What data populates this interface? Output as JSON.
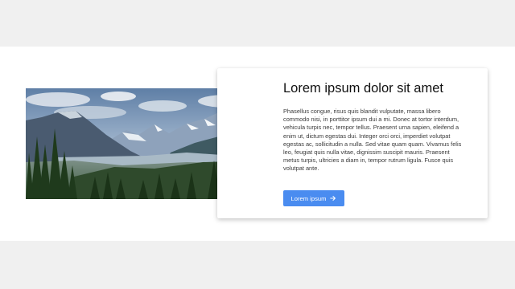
{
  "card": {
    "title": "Lorem ipsum dolor sit amet",
    "body": "Phasellus congue, risus quis blandit vulputate, massa libero commodo nisi, in porttitor ipsum dui a mi. Donec at tortor interdum, vehicula turpis nec, tempor tellus. Praesent urna sapien, eleifend a enim ut, dictum egestas dui. Integer orci orci, imperdiet volutpat egestas ac, sollicitudin a nulla. Sed vitae quam quam. Vivamus felis leo, feugiat quis nulla vitae, dignissim suscipit mauris. Praesent metus turpis, ultricies a diam in, tempor rutrum ligula. Fusce quis volutpat ante.",
    "button_label": "Lorem ipsum",
    "button_icon": "arrow-right-icon",
    "button_color": "#4a8cf0"
  },
  "image": {
    "subject": "mountain-landscape"
  },
  "colors": {
    "page_background": "#f0f0f0",
    "band_background": "#ffffff"
  }
}
